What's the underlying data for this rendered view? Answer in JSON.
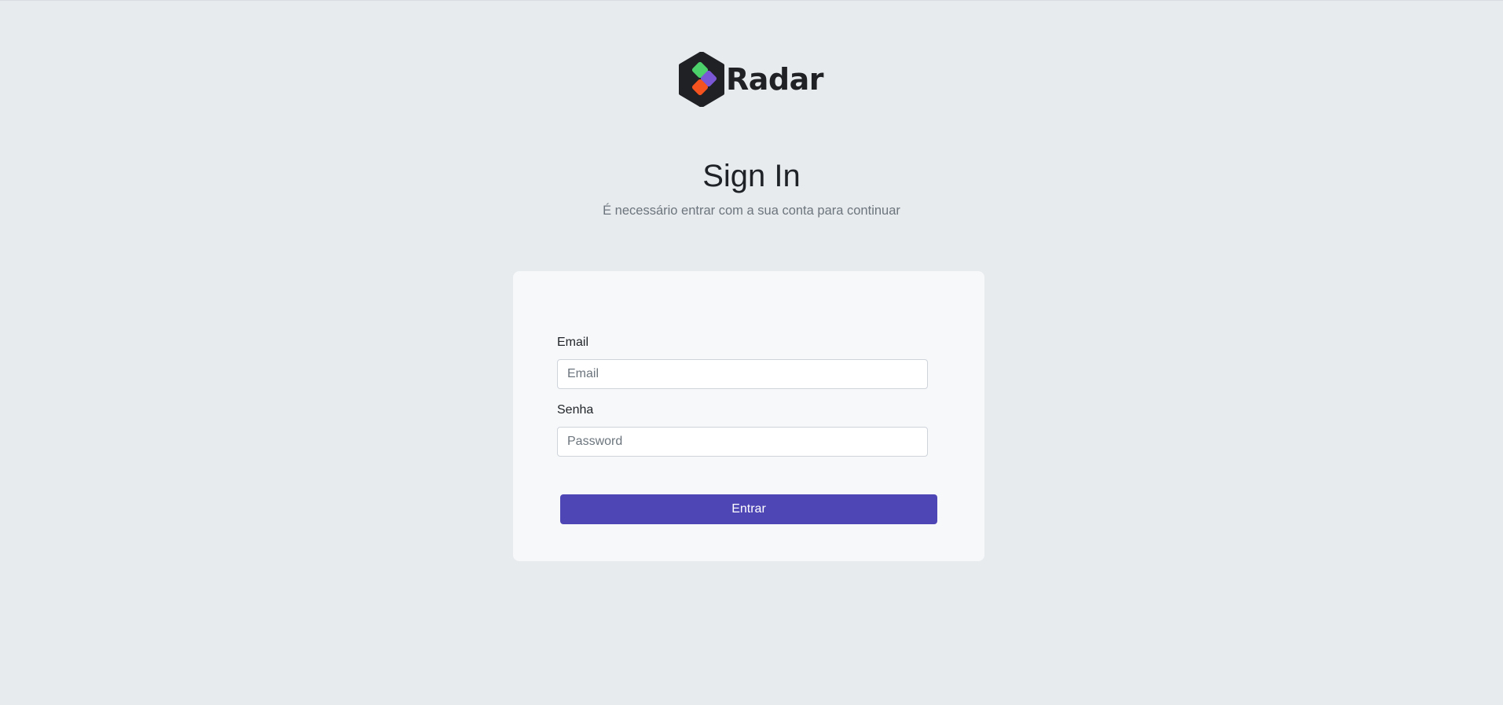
{
  "brand": {
    "name": "Radar",
    "logo_colors": {
      "hexagon": "#1f2125",
      "green": "#4cd06a",
      "purple": "#7957d5",
      "orange": "#f4521e"
    }
  },
  "header": {
    "title": "Sign In",
    "subtitle": "É necessário entrar com a sua conta para continuar"
  },
  "form": {
    "email": {
      "label": "Email",
      "placeholder": "Email",
      "value": ""
    },
    "password": {
      "label": "Senha",
      "placeholder": "Password",
      "value": ""
    },
    "submit_label": "Entrar"
  },
  "colors": {
    "page_background": "#e8ebee",
    "card_background": "#f7f8fa",
    "accent": "#4f46b5",
    "muted_text": "#6c757d"
  }
}
